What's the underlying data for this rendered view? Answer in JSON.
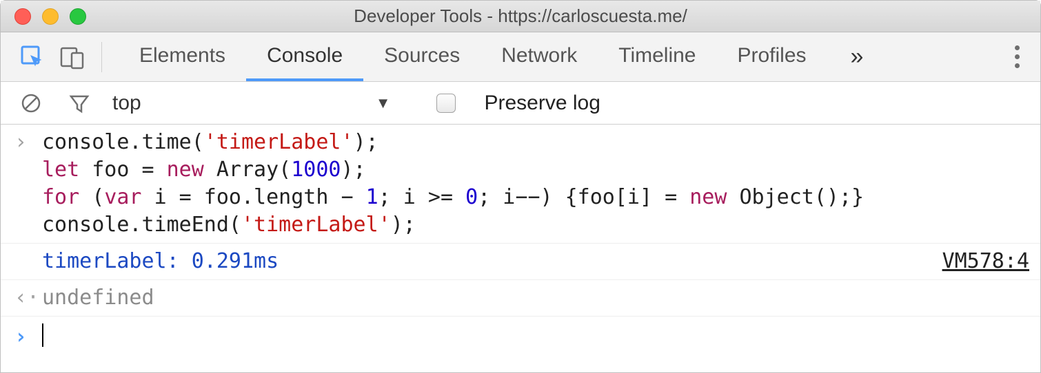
{
  "window": {
    "title": "Developer Tools - https://carloscuesta.me/"
  },
  "tabs": {
    "items": [
      "Elements",
      "Console",
      "Sources",
      "Network",
      "Timeline",
      "Profiles"
    ],
    "active_index": 1
  },
  "console_toolbar": {
    "context": "top",
    "preserve_log_label": "Preserve log",
    "preserve_log_checked": false
  },
  "console": {
    "input_code_tokens": [
      [
        {
          "t": "console.time("
        },
        {
          "t": "'timerLabel'",
          "c": "tok-str"
        },
        {
          "t": ");"
        }
      ],
      [
        {
          "t": "let ",
          "c": "tok-kw"
        },
        {
          "t": "foo = "
        },
        {
          "t": "new ",
          "c": "tok-kw"
        },
        {
          "t": "Array("
        },
        {
          "t": "1000",
          "c": "tok-num"
        },
        {
          "t": ");"
        }
      ],
      [
        {
          "t": "for ",
          "c": "tok-kw"
        },
        {
          "t": "("
        },
        {
          "t": "var ",
          "c": "tok-kw"
        },
        {
          "t": "i = foo.length − "
        },
        {
          "t": "1",
          "c": "tok-num"
        },
        {
          "t": "; i >= "
        },
        {
          "t": "0",
          "c": "tok-num"
        },
        {
          "t": "; i−−) {foo[i] = "
        },
        {
          "t": "new ",
          "c": "tok-kw"
        },
        {
          "t": "Object();}"
        }
      ],
      [
        {
          "t": "console.timeEnd("
        },
        {
          "t": "'timerLabel'",
          "c": "tok-str"
        },
        {
          "t": ");"
        }
      ]
    ],
    "log_output": "timerLabel: 0.291ms",
    "log_source": "VM578:4",
    "return_value": "undefined"
  }
}
